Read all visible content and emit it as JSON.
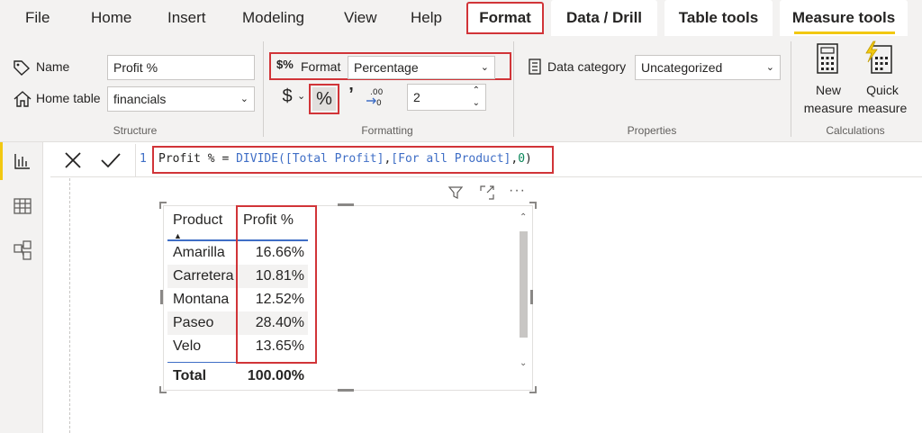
{
  "menu": {
    "tabs": [
      "File",
      "Home",
      "Insert",
      "Modeling",
      "View",
      "Help",
      "Format",
      "Data / Drill",
      "Table tools",
      "Measure tools"
    ],
    "active_tab": "Format"
  },
  "ribbon": {
    "structure": {
      "name_label": "Name",
      "name_value": "Profit %",
      "home_table_label": "Home table",
      "home_table_value": "financials",
      "group_label": "Structure"
    },
    "formatting": {
      "format_label": "Format",
      "format_value": "Percentage",
      "currency_symbol": "$",
      "percent_symbol": "%",
      "comma_symbol": "’",
      "decimals_value": "2",
      "group_label": "Formatting"
    },
    "properties": {
      "data_category_label": "Data category",
      "data_category_value": "Uncategorized",
      "group_label": "Properties"
    },
    "calculations": {
      "new_measure_line1": "New",
      "new_measure_line2": "measure",
      "quick_measure_line1": "Quick",
      "quick_measure_line2": "measure",
      "group_label": "Calculations"
    }
  },
  "formula": {
    "line_number": "1",
    "name_part": "Profit % = ",
    "func": "DIVIDE(",
    "arg1": "[Total Profit]",
    "comma1": ",",
    "arg2": "[For all Product]",
    "comma2": ",",
    "arg3": "0",
    "close": ")"
  },
  "table": {
    "headers": [
      "Product",
      "Profit %"
    ],
    "rows": [
      {
        "product": "Amarilla",
        "value": "16.66%"
      },
      {
        "product": "Carretera",
        "value": "10.81%"
      },
      {
        "product": "Montana",
        "value": "12.52%"
      },
      {
        "product": "Paseo",
        "value": "28.40%"
      },
      {
        "product": "Velo",
        "value": "13.65%"
      }
    ],
    "total_label": "Total",
    "total_value": "100.00%"
  },
  "colors": {
    "accent": "#f2c811",
    "highlight_red": "#d13438",
    "dax_blue": "#3f6ec6"
  }
}
